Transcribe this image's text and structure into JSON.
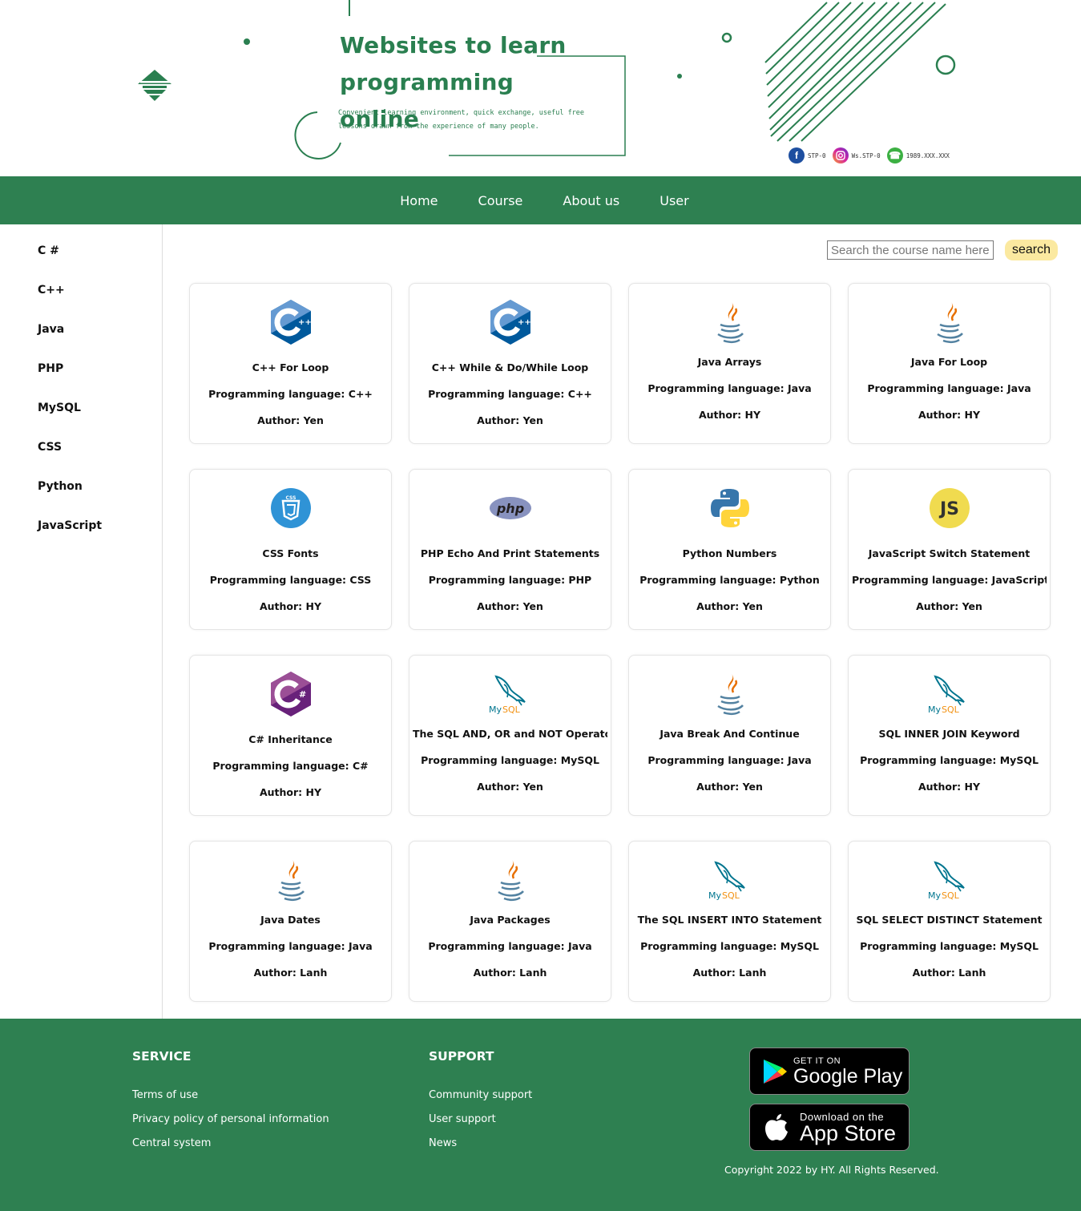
{
  "banner": {
    "title": "Websites to learn programming online",
    "subtitle": "Convenient learning environment, quick exchange, useful free lessons drawn from the experience of many people.",
    "socials": [
      {
        "icon": "facebook-icon",
        "text": "STP-0",
        "color": "#1877f2"
      },
      {
        "icon": "instagram-icon",
        "text": "Ws.STP-0",
        "color": "#d6249f"
      },
      {
        "icon": "phone-icon",
        "text": "1989.XXX.XXX",
        "color": "#25d366"
      }
    ]
  },
  "nav": {
    "items": [
      "Home",
      "Course",
      "About us",
      "User"
    ]
  },
  "sidebar": {
    "items": [
      "C #",
      "C++",
      "Java",
      "PHP",
      "MySQL",
      "CSS",
      "Python",
      "JavaScript"
    ]
  },
  "search": {
    "placeholder": "Search the course name here",
    "button_label": "search"
  },
  "courses": [
    {
      "icon": "cpp-logo-icon",
      "title": "C++ For Loop",
      "language": "Programming language: C++",
      "author": "Author: Yen"
    },
    {
      "icon": "cpp-logo-icon",
      "title": "C++ While & Do/While Loop",
      "language": "Programming language: C++",
      "author": "Author: Yen"
    },
    {
      "icon": "java-logo-icon",
      "title": "Java Arrays",
      "language": "Programming language: Java",
      "author": "Author: HY"
    },
    {
      "icon": "java-logo-icon",
      "title": "Java For Loop",
      "language": "Programming language: Java",
      "author": "Author: HY"
    },
    {
      "icon": "css-logo-icon",
      "title": "CSS Fonts",
      "language": "Programming language: CSS",
      "author": "Author: HY"
    },
    {
      "icon": "php-logo-icon",
      "title": "PHP Echo And Print Statements",
      "language": "Programming language: PHP",
      "author": "Author: Yen"
    },
    {
      "icon": "python-logo-icon",
      "title": "Python Numbers",
      "language": "Programming language: Python",
      "author": "Author: Yen"
    },
    {
      "icon": "javascript-logo-icon",
      "title": "JavaScript Switch Statement",
      "language": "Programming language: JavaScript",
      "author": "Author: Yen"
    },
    {
      "icon": "csharp-logo-icon",
      "title": "C# Inheritance",
      "language": "Programming language: C#",
      "author": "Author: HY"
    },
    {
      "icon": "mysql-logo-icon",
      "title": "The SQL AND, OR and NOT Operators",
      "language": "Programming language: MySQL",
      "author": "Author: Yen"
    },
    {
      "icon": "java-logo-icon",
      "title": "Java Break And Continue",
      "language": "Programming language: Java",
      "author": "Author: Yen"
    },
    {
      "icon": "mysql-logo-icon",
      "title": "SQL INNER JOIN Keyword",
      "language": "Programming language: MySQL",
      "author": "Author: HY"
    },
    {
      "icon": "java-logo-icon",
      "title": "Java Dates",
      "language": "Programming language: Java",
      "author": "Author: Lanh"
    },
    {
      "icon": "java-logo-icon",
      "title": "Java Packages",
      "language": "Programming language: Java",
      "author": "Author: Lanh"
    },
    {
      "icon": "mysql-logo-icon",
      "title": "The SQL INSERT INTO Statement",
      "language": "Programming language: MySQL",
      "author": "Author: Lanh"
    },
    {
      "icon": "mysql-logo-icon",
      "title": "SQL SELECT DISTINCT Statement",
      "language": "Programming language: MySQL",
      "author": "Author: Lanh"
    }
  ],
  "footer": {
    "service": {
      "heading": "SERVICE",
      "links": [
        "Terms of use",
        "Privacy policy of personal information",
        "Central system"
      ]
    },
    "support": {
      "heading": "SUPPORT",
      "links": [
        "Community support",
        "User support",
        "News"
      ]
    },
    "google_play": {
      "small": "GET IT ON",
      "big": "Google Play"
    },
    "app_store": {
      "small": "Download on the",
      "big": "App Store"
    },
    "copyright": "Copyright 2022 by HY. All Rights Reserved."
  },
  "colors": {
    "brand_green": "#2e8051",
    "search_button": "#fbe9a0"
  }
}
